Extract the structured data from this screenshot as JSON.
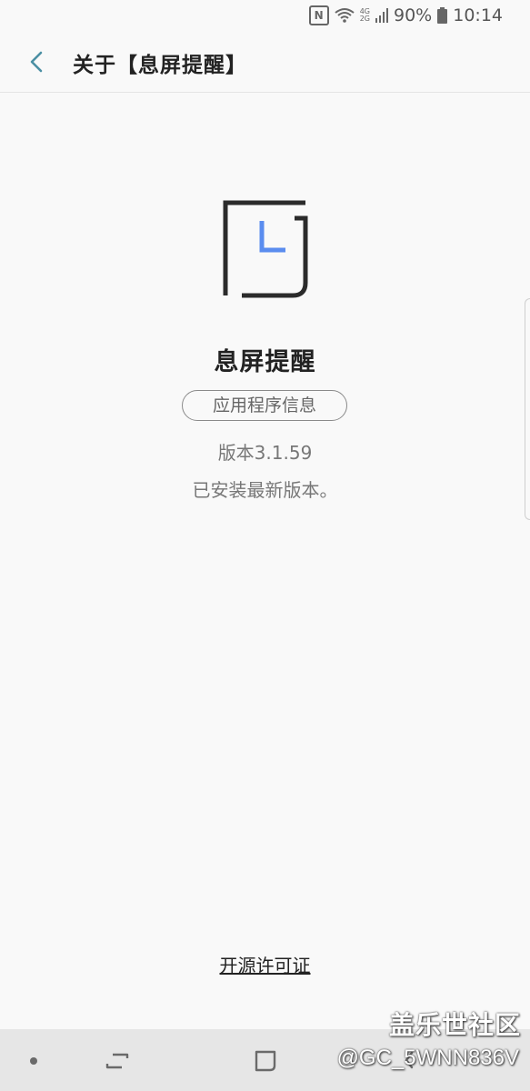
{
  "status_bar": {
    "battery": "90%",
    "time": "10:14",
    "network_top": "4G",
    "network_bottom": "2G",
    "icons": [
      "nfc-icon",
      "wifi-icon",
      "signal-icon",
      "battery-icon"
    ]
  },
  "header": {
    "title": "关于【息屏提醒】",
    "back_icon": "chevron-left-icon"
  },
  "app": {
    "name": "息屏提醒",
    "info_button": "应用程序信息",
    "version": "版本3.1.59",
    "status": "已安装最新版本。",
    "logo_colors": {
      "frame": "#2b2b2b",
      "accent": "#5b8def"
    }
  },
  "footer": {
    "license_link": "开源许可证"
  },
  "nav_bar": {
    "icons": [
      "nav-dot-icon",
      "recents-icon",
      "home-icon",
      "back-icon"
    ]
  },
  "watermark": {
    "title": "盖乐世社区",
    "id": "@GC_5WNN836V"
  },
  "colors": {
    "accent_teal": "#4a8fa3",
    "background": "#f9f9f9",
    "nav_background": "#e6e6e6"
  }
}
